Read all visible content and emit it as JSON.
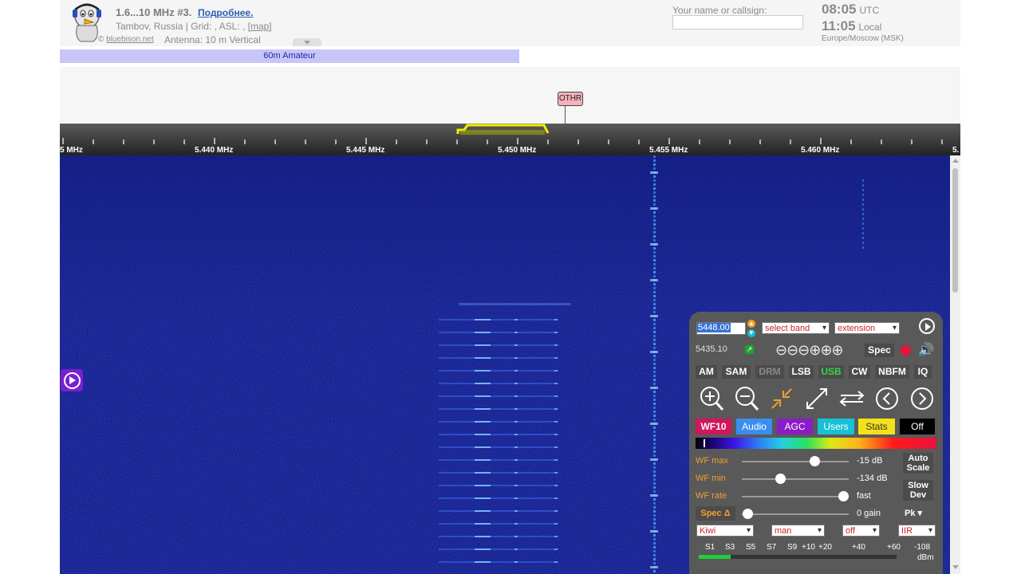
{
  "header": {
    "title": "1.6...10 MHz #3.",
    "title_link": "Подробнее.",
    "location": "Tambov, Russia | Grid: , ASL: , ",
    "map_link": "[map]",
    "credit_symbol": "©",
    "credit_link": "bluebison.net",
    "antenna": "Antenna: 10 m Vertical",
    "name_label": "Your name or callsign:",
    "name_value": "",
    "utc_time": "08:05",
    "utc_label": "UTC",
    "local_time": "11:05",
    "local_label": "Local",
    "timezone": "Europe/Moscow (MSK)"
  },
  "band": {
    "label": "60m Amateur",
    "color": "#c8c6f8"
  },
  "dx": {
    "label": "OTHR",
    "color": "#f6b1bb"
  },
  "scale": {
    "labels": [
      "5 MHz",
      "5.440 MHz",
      "5.445 MHz",
      "5.450 MHz",
      "5.455 MHz",
      "5.460 MHz",
      "5."
    ]
  },
  "panel": {
    "frequency": "5448.00",
    "last_freq": "5435.10",
    "band_select": "select band",
    "extension_select": "extension",
    "zoom_glyphs": "⊖⊖⊖⊕⊕⊕",
    "spec_label": "Spec",
    "modes": [
      "AM",
      "SAM",
      "DRM",
      "LSB",
      "USB",
      "CW",
      "NBFM",
      "IQ"
    ],
    "active_mode": "USB",
    "buttons": [
      {
        "label": "WF10",
        "bg": "#d0165c"
      },
      {
        "label": "Audio",
        "bg": "#3a8ef0"
      },
      {
        "label": "AGC",
        "bg": "#8a1cc7"
      },
      {
        "label": "Users",
        "bg": "#17c1d6"
      },
      {
        "label": "Stats",
        "bg": "#f4e11a"
      },
      {
        "label": "Off",
        "bg": "#000000"
      }
    ],
    "wf_max_label": "WF max",
    "wf_max_value": "-15 dB",
    "wf_max_pos": 0.68,
    "wf_min_label": "WF min",
    "wf_min_value": "-134 dB",
    "wf_min_pos": 0.36,
    "wf_rate_label": "WF rate",
    "wf_rate_value": "fast",
    "wf_rate_pos": 0.95,
    "spec_delta_label": "Spec Δ",
    "spec_delta_value": "0 gain",
    "spec_delta_pos": 0.05,
    "auto_scale_1": "Auto",
    "auto_scale_2": "Scale",
    "slow_dev_1": "Slow",
    "slow_dev_2": "Dev",
    "pk_label": "Pk ▾",
    "dd1": "Kiwi",
    "dd2": "man",
    "dd3": "off",
    "dd4": "IIR",
    "smeter_labels": [
      "S1",
      "S3",
      "S5",
      "S7",
      "S9",
      "+10",
      "+20",
      "+40",
      "+60",
      "-108"
    ],
    "dbm_label": "dBm"
  }
}
